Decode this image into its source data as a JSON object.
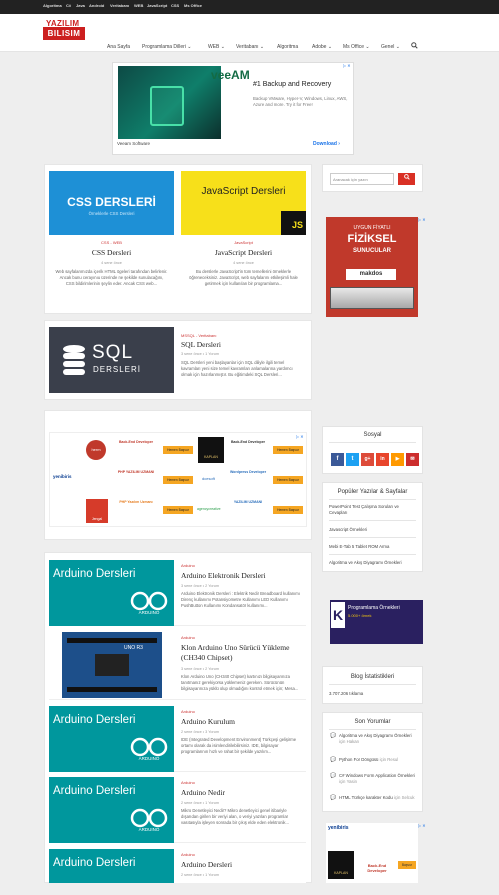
{
  "topbar": {
    "links": [
      "Algoritma",
      "C#",
      "Java",
      "Android",
      "Veritabanı",
      "WEB",
      "JavaScript",
      "CSS",
      "Ms Office"
    ]
  },
  "logo": {
    "line1": "YAZILIM",
    "line2": "BILISIM"
  },
  "nav": {
    "items": [
      "Ana Sayfa",
      "Programlama Dilleri ⌄",
      "WEB ⌄",
      "Veritabanı ⌄",
      "Algoritma",
      "Adobe ⌄",
      "Ms Office ⌄",
      "Genel ⌄"
    ],
    "search_icon": "search-icon"
  },
  "top_ad": {
    "brand": "veeAM",
    "headline": "#1 Backup and Recovery",
    "desc": "Backup VMware, Hyper-V, Windows, Linux, AWS, Azure and more. Try it for Free!",
    "source": "Veeam Software",
    "cta": "Download ›",
    "badge": "▷ ✕"
  },
  "courses": [
    {
      "banner": "CSS DERSLERİ",
      "banner_sub": "Örneklerle CSS Dersleri",
      "category": "CSS - WEB",
      "title": "CSS Dersleri",
      "meta": "4 sene önce",
      "excerpt": "Web sayfalarımızda içerik HTML ögeleri tarafından belirlenir. Ancak bunu cerayınıu üzerinde ne şekilde sunulacağını, CSS bildirimlerinin şeylin eder. Ancak CSS web..."
    },
    {
      "banner": "JavaScript Dersleri",
      "badge": "JS",
      "category": "JavaScript",
      "title": "JavaScript Dersleri",
      "meta": "4 sene önce",
      "excerpt": "Bu derslerle JavaScript'in tüm temellerini örneklerle öğreneceksiniz. JavaScript, web sayfalarını etkileşimli hale getirmek için kullanılan bir programlama..."
    }
  ],
  "sql_card": {
    "banner": "SQL",
    "banner_sub": "DERSLERİ",
    "category": "MSSQL - Veritabanı",
    "title": "SQL Dersleri",
    "meta": "3 sene önce • 1 Yorum",
    "excerpt": "SQL Dersleri yeni başlayanlar için SQL diliyle ilgili temel kavramları yeni size temel kavramları anlamalarına yardımcı olmak için hazırlanmıştır. Bu eğitimdeki SQL Dersleri..."
  },
  "job_ad": {
    "badge": "▷ ✕",
    "rows": [
      {
        "company": "herm",
        "role": "Back-End Developer",
        "btn": "Hemen Başvur",
        "company2": "KAPLAN",
        "role2": "Back-End Developer",
        "btn2": "Hemen Başvur"
      },
      {
        "company": "yenibiris",
        "role": "PHP YAZILIM UZMANI",
        "btn": "Hemen Başvur",
        "company2": "dcesoft",
        "role2": "Wordpress Developer",
        "btn2": "Hemen Başvur"
      },
      {
        "company": "Jengal",
        "role": "PHP Yazılım Uzmanı",
        "btn": "Hemen Başvur",
        "company2": "agencycreative",
        "role2": "YAZILIM UZMANI",
        "btn2": "Hemen Başvur"
      }
    ]
  },
  "articles": [
    {
      "banner": "Arduino Dersleri",
      "category": "Arduino",
      "title": "Arduino Elektronik Dersleri",
      "meta": "3 sene önce • 2 Yorum",
      "excerpt": "Arduino Elektronik Dersleri : Elektrik Nedir Breadboard kullanımı Direnç kullanımı Potansiyometre Kullanımı LED Kullanımı PushButton Kullanımı Kondansatör kullanımı..."
    },
    {
      "banner": "UNO R3",
      "category": "Arduino",
      "title": "Klon Arduino Uno Sürücü Yükleme (CH340 Chipset)",
      "meta": "3 sene önce • 2 Yorum",
      "excerpt": "Klon Arduino Uno (CH340 Chipset) kartınızı bilgisayarınıza tanıtmanız gerekiyorsa yüklemeniz gereken. Sürücünün bilgisayarınıza yüklü olup olmadığını kontrol etmek için; Mesa..."
    },
    {
      "banner": "Arduino Dersleri",
      "category": "Arduino",
      "title": "Arduino Kurulum",
      "meta": "2 sene önce • 3 Yorum",
      "excerpt": "IDE (Integrated Development Environment) Türkçeşi gelişirme ortamı olarak da isimlendirilebilirsiniz. IDE, bilgisayar programlarının hızlı ve rahat bir şekilde yazılım..."
    },
    {
      "banner": "Arduino Dersleri",
      "category": "Arduino",
      "title": "Arduino Nedir",
      "meta": "2 sene önce • 1 Yorum",
      "excerpt": "Mikro Denetleyici Nedir? Mikro denetleyici genel itibariyle dışarıdan girilen bir veriyi alan, o veriyi yazılan programlar vasıtasıyla işleyen sonrada bir çıkış elde eden elektronik..."
    },
    {
      "banner": "Arduino Dersleri",
      "category": "Arduino",
      "title": "Arduino Dersleri",
      "meta": "2 sene önce • 1 Yorum",
      "excerpt": ""
    }
  ],
  "sidebar": {
    "search_placeholder": "Aranacak için yazın",
    "search_btn": "🔍",
    "ad1": {
      "line1": "UYGUN FİYATLI",
      "line2": "FİZİKSEL",
      "line3": "SUNUCULAR",
      "brand": "makdos"
    },
    "social_title": "Sosyal",
    "social": [
      "f",
      "t",
      "g+",
      "in",
      "▶",
      "✉"
    ],
    "popular_title": "Popüler Yazılar & Sayfalar",
    "popular": [
      "PowerPoint Test Çalışma Soruları ve Cevapları",
      "Javascript Örnekleri",
      "Mebi E-Tab 5 Tablet ROM Arma",
      "Algoritma ve Akış Diyagramı Örnekleri"
    ],
    "banner2": {
      "title": "Programlama Örnekleri",
      "sub": "5.000+ örnek"
    },
    "stats_title": "Blog İstatistikleri",
    "stats": "3.707.206 tıklama",
    "comments_title": "Son Yorumlar",
    "comments": [
      {
        "text": "Algoritma ve Akış Diyagramı Örnekleri",
        "by": "için Hakan"
      },
      {
        "text": "Python For Döngüsü",
        "by": "için Resul"
      },
      {
        "text": "C# Windows Form Application Örnekleri",
        "by": "için Yasin"
      },
      {
        "text": "HTML Türkçe karakter Kodu",
        "by": "için Selcuk"
      }
    ],
    "ad3": {
      "brand": "yenibiris",
      "role": "Back-End Developer",
      "company": "KAPLAN",
      "btn": "Başvur"
    }
  }
}
